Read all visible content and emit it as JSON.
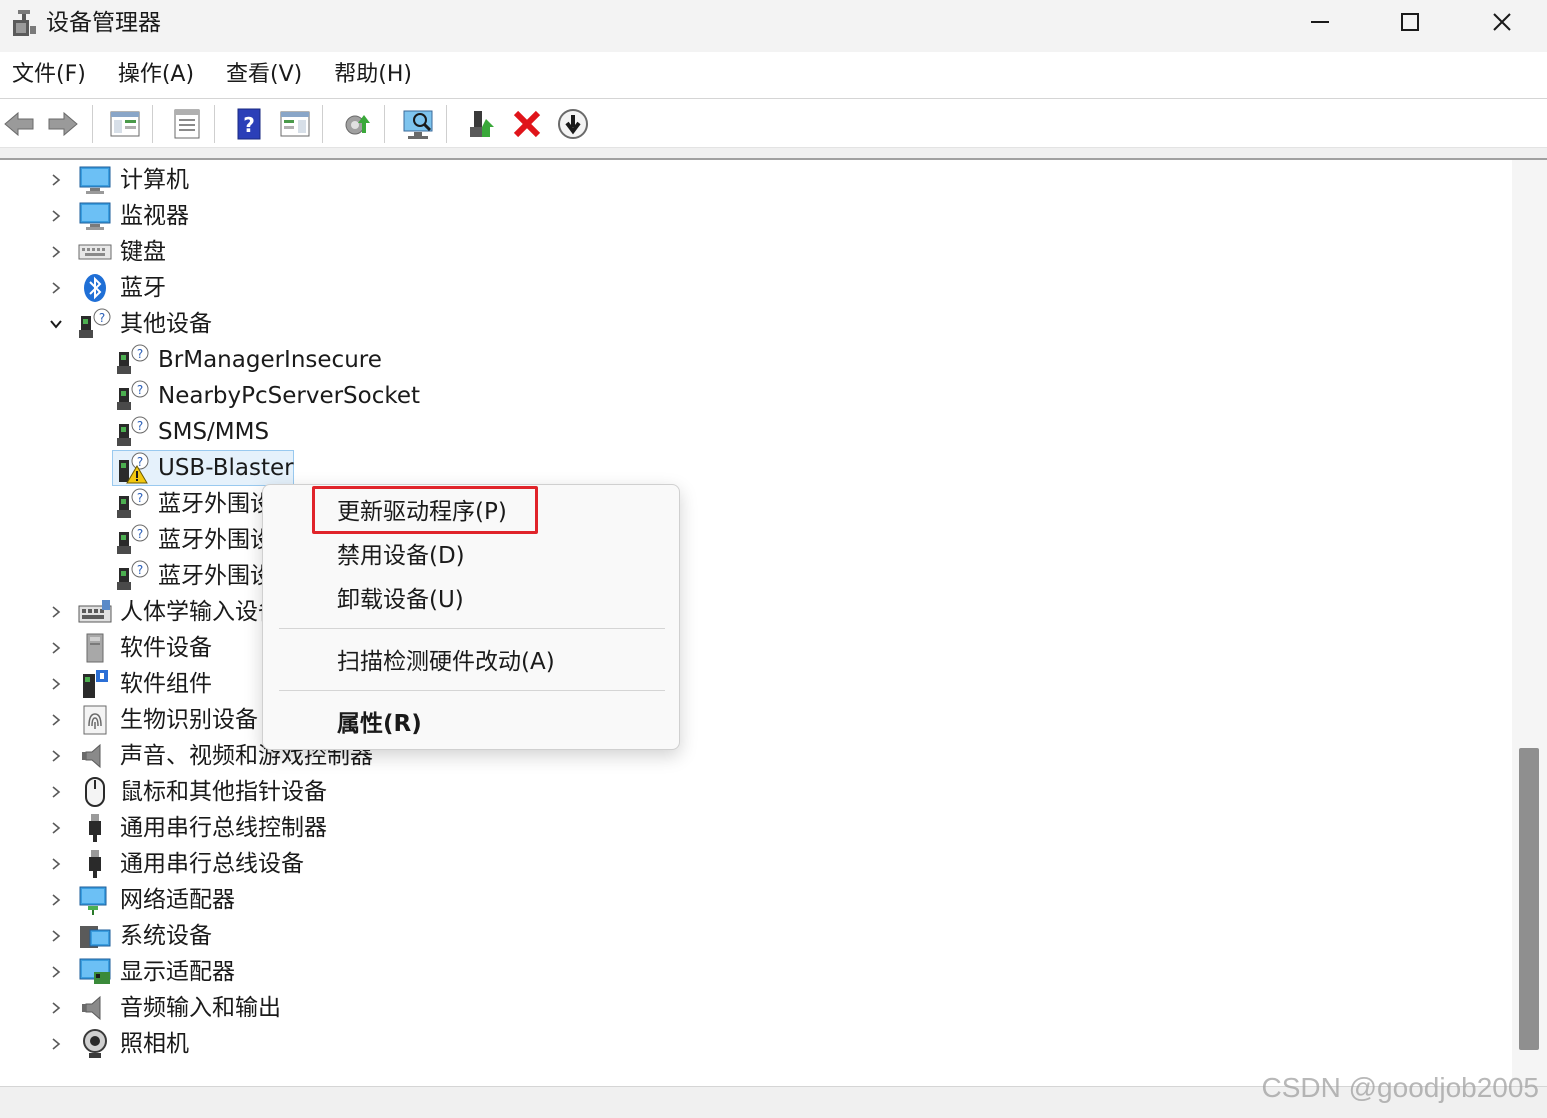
{
  "window": {
    "title": "设备管理器"
  },
  "menubar": {
    "items": [
      "文件(F)",
      "操作(A)",
      "查看(V)",
      "帮助(H)"
    ]
  },
  "toolbar": {
    "buttons": [
      {
        "icon": "back-arrow-icon"
      },
      {
        "icon": "forward-arrow-icon"
      },
      {
        "icon": "show-hide-console-tree-icon"
      },
      {
        "icon": "properties-sheet-icon"
      },
      {
        "icon": "help-icon"
      },
      {
        "icon": "action-pane-icon"
      },
      {
        "icon": "update-driver-icon"
      },
      {
        "icon": "scan-hardware-icon"
      },
      {
        "icon": "enable-device-icon"
      },
      {
        "icon": "uninstall-device-icon"
      },
      {
        "icon": "disable-device-icon"
      }
    ]
  },
  "tree": {
    "items": [
      {
        "label": "计算机",
        "level": 0,
        "expanded": false,
        "icon": "computer-icon"
      },
      {
        "label": "监视器",
        "level": 0,
        "expanded": false,
        "icon": "monitor-icon"
      },
      {
        "label": "键盘",
        "level": 0,
        "expanded": false,
        "icon": "keyboard-icon"
      },
      {
        "label": "蓝牙",
        "level": 0,
        "expanded": false,
        "icon": "bluetooth-icon"
      },
      {
        "label": "其他设备",
        "level": 0,
        "expanded": true,
        "icon": "unknown-device-icon"
      },
      {
        "label": "BrManagerInsecure",
        "level": 1,
        "icon": "unknown-device-icon"
      },
      {
        "label": "NearbyPcServerSocket",
        "level": 1,
        "icon": "unknown-device-icon"
      },
      {
        "label": "SMS/MMS",
        "level": 1,
        "icon": "unknown-device-icon"
      },
      {
        "label": "USB-Blaster",
        "level": 1,
        "icon": "warning-device-icon",
        "selected": true
      },
      {
        "label": "蓝牙外围设备",
        "level": 1,
        "icon": "unknown-device-icon"
      },
      {
        "label": "蓝牙外围设备",
        "level": 1,
        "icon": "unknown-device-icon"
      },
      {
        "label": "蓝牙外围设备",
        "level": 1,
        "icon": "unknown-device-icon"
      },
      {
        "label": "人体学输入设备",
        "level": 0,
        "expanded": false,
        "icon": "hid-icon"
      },
      {
        "label": "软件设备",
        "level": 0,
        "expanded": false,
        "icon": "software-device-icon"
      },
      {
        "label": "软件组件",
        "level": 0,
        "expanded": false,
        "icon": "software-component-icon"
      },
      {
        "label": "生物识别设备",
        "level": 0,
        "expanded": false,
        "icon": "fingerprint-icon"
      },
      {
        "label": "声音、视频和游戏控制器",
        "level": 0,
        "expanded": false,
        "icon": "speaker-icon"
      },
      {
        "label": "鼠标和其他指针设备",
        "level": 0,
        "expanded": false,
        "icon": "mouse-icon"
      },
      {
        "label": "通用串行总线控制器",
        "level": 0,
        "expanded": false,
        "icon": "usb-icon"
      },
      {
        "label": "通用串行总线设备",
        "level": 0,
        "expanded": false,
        "icon": "usb-icon"
      },
      {
        "label": "网络适配器",
        "level": 0,
        "expanded": false,
        "icon": "network-adapter-icon"
      },
      {
        "label": "系统设备",
        "level": 0,
        "expanded": false,
        "icon": "system-device-icon"
      },
      {
        "label": "显示适配器",
        "level": 0,
        "expanded": false,
        "icon": "display-adapter-icon"
      },
      {
        "label": "音频输入和输出",
        "level": 0,
        "expanded": false,
        "icon": "speaker-icon"
      },
      {
        "label": "照相机",
        "level": 0,
        "expanded": false,
        "icon": "camera-icon"
      }
    ]
  },
  "context_menu": {
    "items": [
      {
        "label": "更新驱动程序(P)",
        "highlighted": true
      },
      {
        "label": "禁用设备(D)"
      },
      {
        "label": "卸载设备(U)"
      },
      {
        "label": "扫描检测硬件改动(A)"
      },
      {
        "label": "属性(R)",
        "bold": true
      }
    ]
  },
  "colors": {
    "highlight_box": "#e0242a",
    "selection_bg": "#e5f1fb",
    "selection_border": "#99c9ef"
  },
  "watermark": "CSDN @goodjob2005"
}
